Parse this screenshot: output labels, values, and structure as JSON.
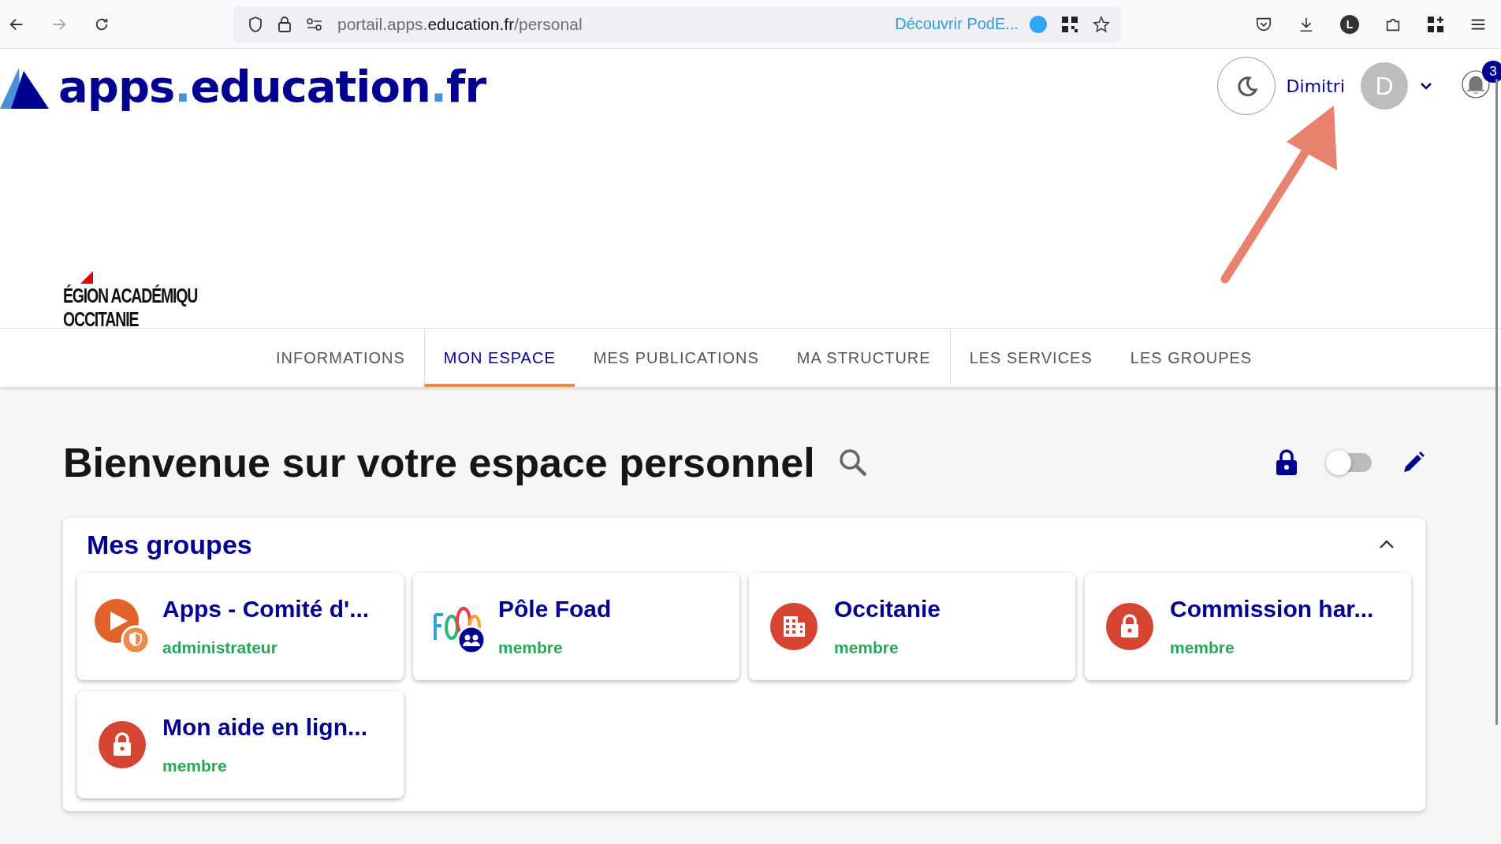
{
  "browser": {
    "url": {
      "prefix": "portail.apps.",
      "domain": "education.fr",
      "path": "/personal"
    },
    "promo": "Découvrir PodE...",
    "profile_initial": "L"
  },
  "header": {
    "logo": "apps.education.fr",
    "user": {
      "name": "Dimitri",
      "initial": "D"
    },
    "notifications": {
      "count": "3"
    }
  },
  "region_logo": {
    "line_1": "ÉGION ACADÉMIQU",
    "line_2": "OCCITANIE"
  },
  "tabs": [
    {
      "label": "INFORMATIONS",
      "selected": false,
      "separated": false
    },
    {
      "label": "MON ESPACE",
      "selected": true,
      "separated": true
    },
    {
      "label": "MES PUBLICATIONS",
      "selected": false,
      "separated": false
    },
    {
      "label": "MA STRUCTURE",
      "selected": false,
      "separated": false
    },
    {
      "label": "LES SERVICES",
      "selected": false,
      "separated": true
    },
    {
      "label": "LES GROUPES",
      "selected": false,
      "separated": false
    }
  ],
  "page": {
    "title": "Bienvenue sur votre espace personnel",
    "edit_mode": {
      "on": false
    }
  },
  "groups_panel": {
    "title": "Mes groupes",
    "expanded": true,
    "groups": [
      {
        "name": "Apps - Comité d'...",
        "role": "administrateur",
        "kind": "video"
      },
      {
        "name": "Pôle Foad",
        "role": "membre",
        "kind": "foad"
      },
      {
        "name": "Occitanie",
        "role": "membre",
        "kind": "building"
      },
      {
        "name": "Commission har...",
        "role": "membre",
        "kind": "lock"
      },
      {
        "name": "Mon aide en lign...",
        "role": "membre",
        "kind": "lock"
      }
    ]
  }
}
